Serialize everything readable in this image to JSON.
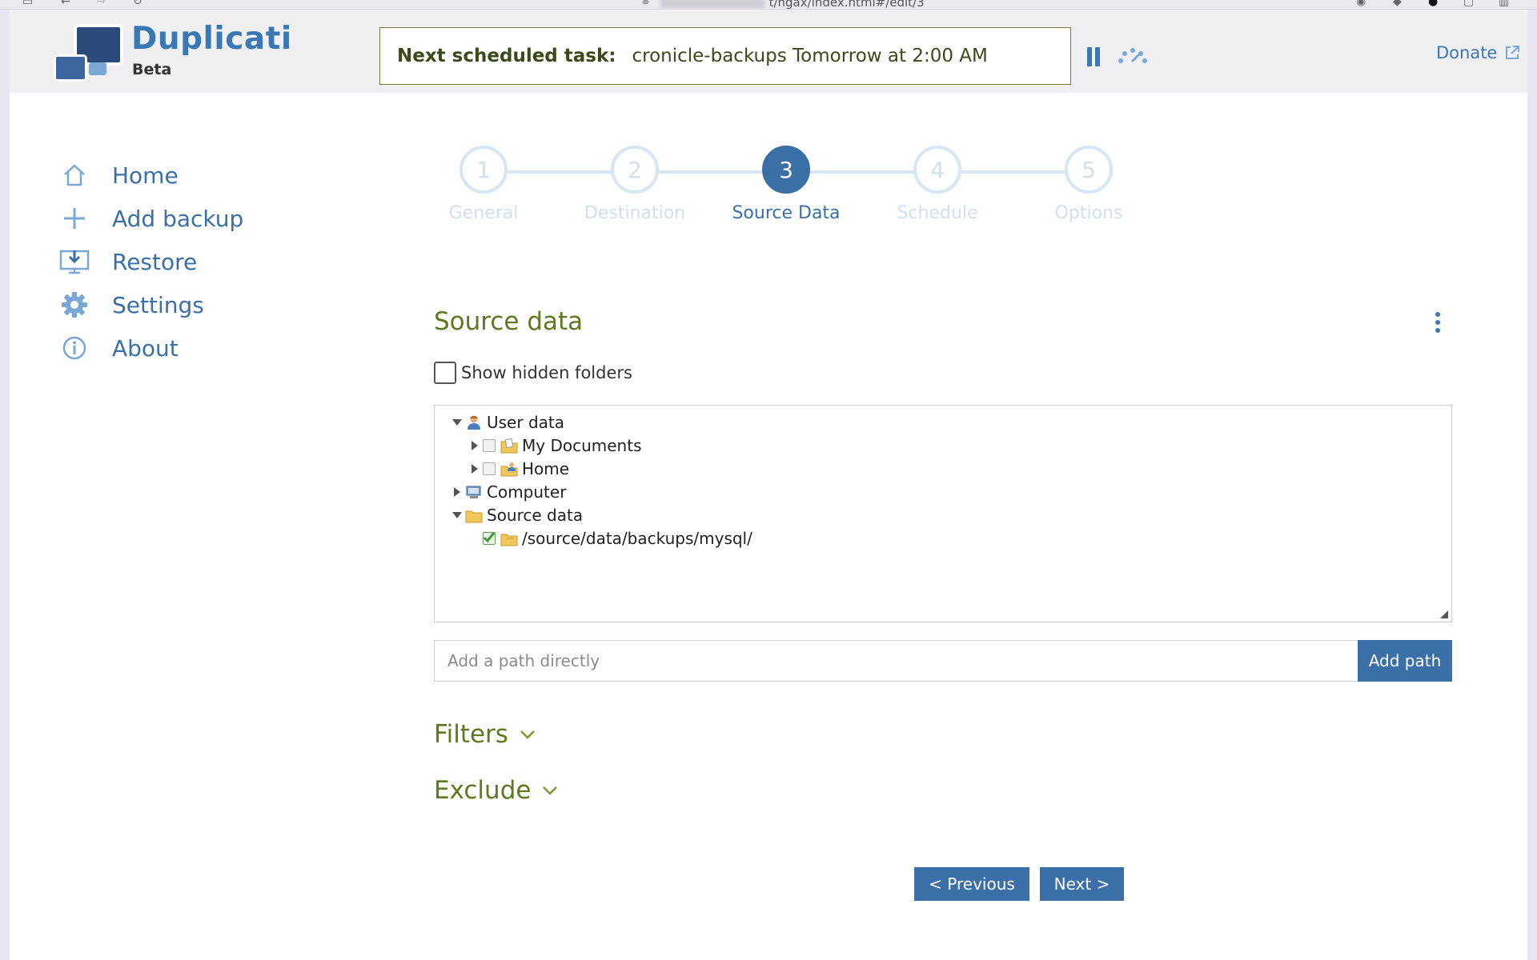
{
  "browser": {
    "url_tail": "t/ngax/index.html#/edit/3"
  },
  "header": {
    "brand": "Duplicati",
    "brand_sub": "Beta",
    "schedule_label": "Next scheduled task:",
    "schedule_value": "cronicle-backups Tomorrow at 2:00 AM",
    "donate_label": "Donate"
  },
  "sidebar": {
    "items": [
      {
        "label": "Home",
        "icon": "home-icon"
      },
      {
        "label": "Add backup",
        "icon": "plus-icon"
      },
      {
        "label": "Restore",
        "icon": "restore-icon"
      },
      {
        "label": "Settings",
        "icon": "gear-icon"
      },
      {
        "label": "About",
        "icon": "info-icon"
      }
    ]
  },
  "wizard": {
    "steps": [
      {
        "number": "1",
        "label": "General"
      },
      {
        "number": "2",
        "label": "Destination"
      },
      {
        "number": "3",
        "label": "Source Data"
      },
      {
        "number": "4",
        "label": "Schedule"
      },
      {
        "number": "5",
        "label": "Options"
      }
    ],
    "active_step": 3
  },
  "source": {
    "title": "Source data",
    "show_hidden_label": "Show hidden folders",
    "tree": {
      "user_data": "User data",
      "my_documents": "My Documents",
      "home": "Home",
      "computer": "Computer",
      "source_data": "Source data",
      "selected_path": "/source/data/backups/mysql/"
    },
    "path_placeholder": "Add a path directly",
    "add_path_label": "Add path",
    "filters_label": "Filters",
    "exclude_label": "Exclude"
  },
  "footer": {
    "previous_label": "< Previous",
    "next_label": "Next >"
  },
  "colors": {
    "accent": "#3a6fa8",
    "brand_blue": "#3a78b5",
    "section_green": "#5d7a1e",
    "step_inactive": "#d6e6f2"
  }
}
